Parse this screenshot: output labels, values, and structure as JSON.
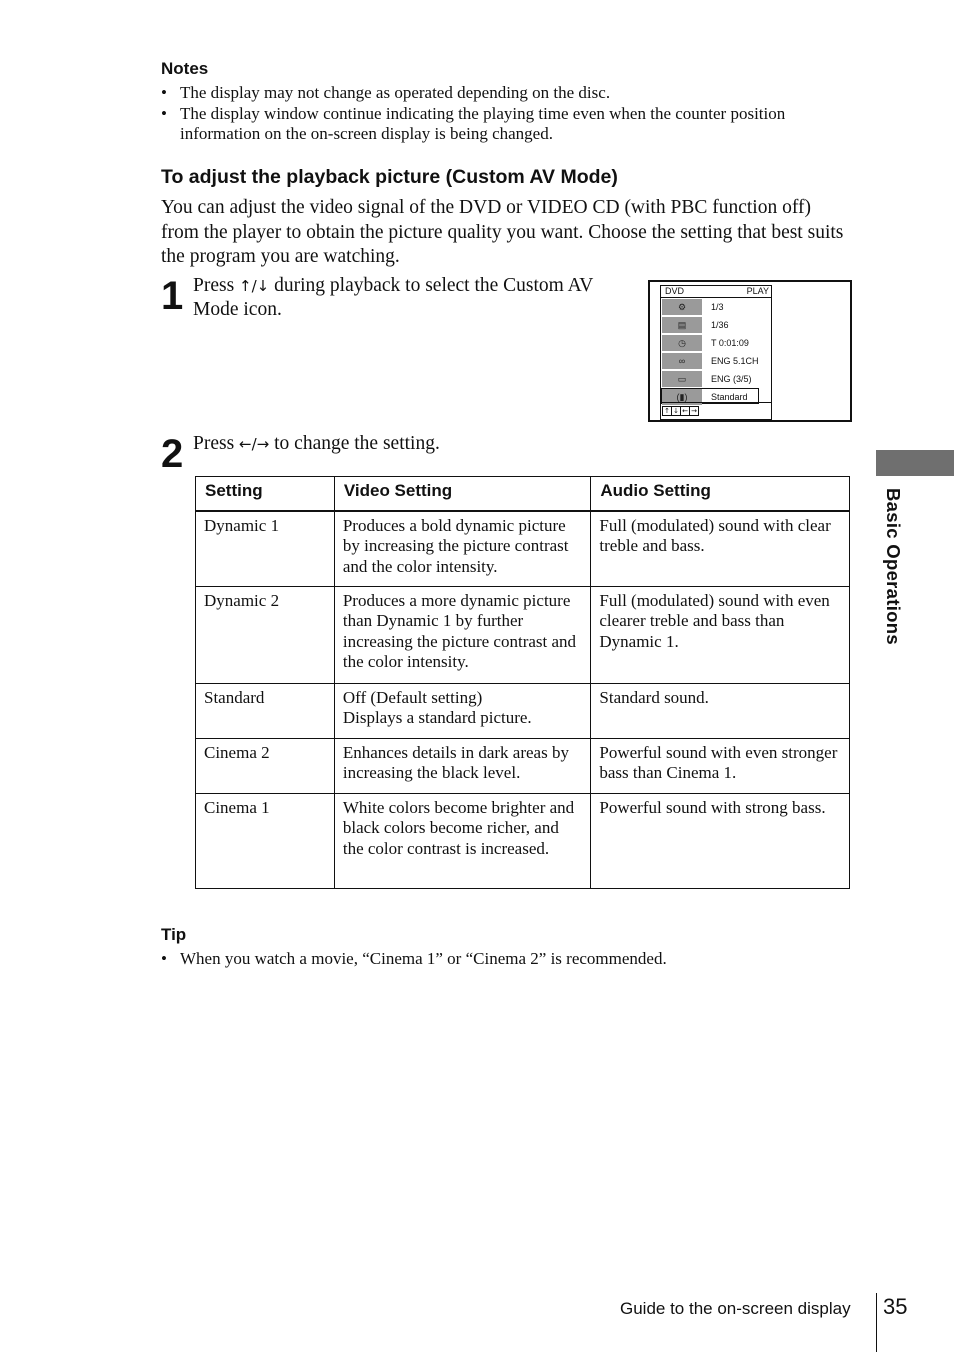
{
  "notes": {
    "heading": "Notes",
    "items": [
      "The display may not change as operated depending on the disc.",
      "The display window continue indicating the playing time even when the counter position information on the on-screen display is being changed."
    ]
  },
  "section": {
    "title": "To adjust the playback picture (Custom AV Mode)",
    "intro": "You can adjust the video signal of the DVD or VIDEO CD (with PBC function off) from the player to obtain the picture quality you want.  Choose the setting that best suits the program you are watching."
  },
  "steps": [
    {
      "number": "1",
      "text_before": "Press ",
      "keys": "↑/↓",
      "text_after": " during playback to select the Custom AV Mode icon."
    },
    {
      "number": "2",
      "text_before": "Press ",
      "keys": "←/→",
      "text_after": " to change the setting."
    }
  ],
  "osd": {
    "header_left": "DVD",
    "header_right": "PLAY",
    "rows": [
      {
        "icon": "title-icon",
        "glyph": "⚙",
        "value": "1/3"
      },
      {
        "icon": "chapter-icon",
        "glyph": "▤",
        "value": "1/36"
      },
      {
        "icon": "clock-icon",
        "glyph": "◷",
        "value": "T 0:01:09"
      },
      {
        "icon": "audio-icon",
        "glyph": "∞",
        "value": "ENG 5.1CH"
      },
      {
        "icon": "subtitle-icon",
        "glyph": "▭",
        "value": "ENG (3/5)"
      },
      {
        "icon": "custom-av-mode-icon",
        "glyph": "(▮)",
        "value": "Standard"
      }
    ],
    "keys": [
      "↑",
      "↓",
      "←",
      "→"
    ]
  },
  "table": {
    "headers": [
      "Setting",
      "Video Setting",
      "Audio Setting"
    ],
    "rows": [
      {
        "setting": "Dynamic 1",
        "video": "Produces a bold dynamic picture by increasing the picture contrast and the color intensity.",
        "audio": "Full (modulated) sound with clear treble and bass."
      },
      {
        "setting": "Dynamic 2",
        "video": "Produces a more dynamic picture than Dynamic 1 by further increasing the picture contrast and the color intensity.",
        "audio": "Full (modulated) sound with even clearer treble and bass than Dynamic 1."
      },
      {
        "setting": "Standard",
        "video_line1": "Off (Default setting)",
        "video_line2": "Displays a standard picture.",
        "audio": "Standard sound."
      },
      {
        "setting": "Cinema 2",
        "video": "Enhances details in dark areas by increasing the black level.",
        "audio": "Powerful sound with even stronger bass than Cinema 1."
      },
      {
        "setting": "Cinema 1",
        "video": "White colors become brighter and black colors become richer, and the color contrast is increased.",
        "audio": "Powerful sound with strong bass."
      }
    ]
  },
  "tip": {
    "heading": "Tip",
    "items": [
      "When you watch a movie, “Cinema 1” or “Cinema 2” is recommended."
    ]
  },
  "side_tab": {
    "label": "Basic Operations",
    "color": "#6f6f6f"
  },
  "footer": {
    "section": "Guide to the on-screen display",
    "page_number": "35"
  }
}
